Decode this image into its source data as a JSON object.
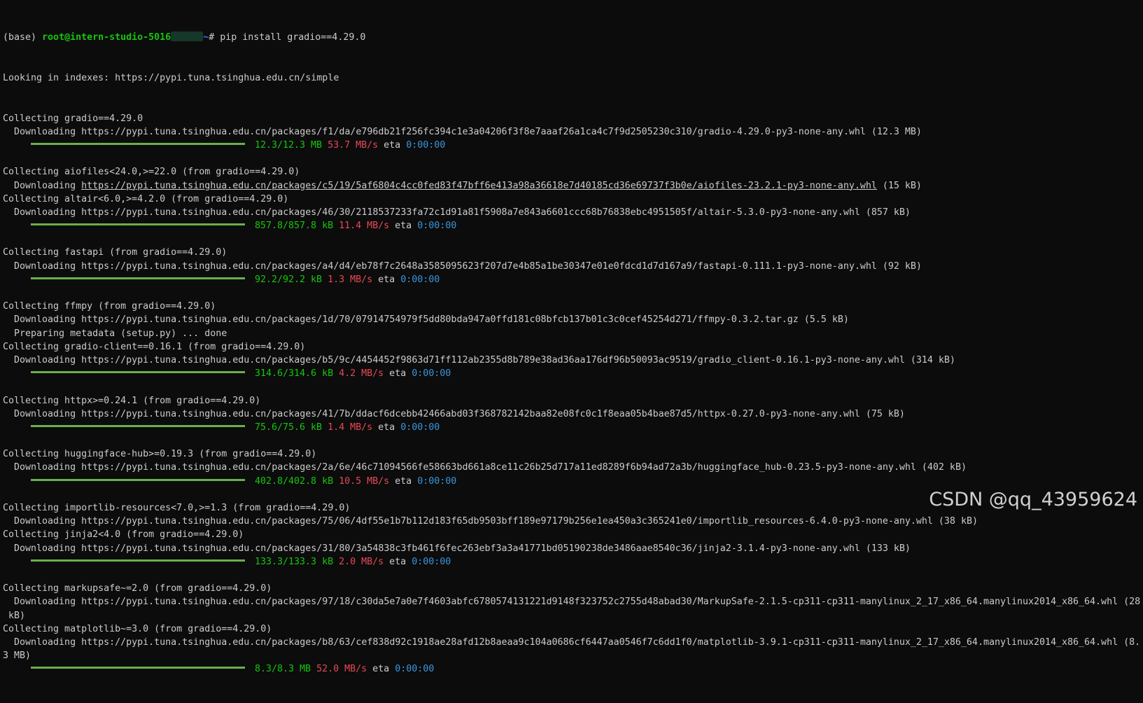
{
  "prompt": {
    "env": "(base) ",
    "user_host": "root@intern-studio-5016",
    "path": "~",
    "symbol": "# ",
    "command": "pip install gradio==4.29.0"
  },
  "index_line": "Looking in indexes: https://pypi.tuna.tsinghua.edu.cn/simple",
  "packages": [
    {
      "collecting": "Collecting gradio==4.29.0",
      "url": "https://pypi.tuna.tsinghua.edu.cn/packages/f1/da/e796db21f256fc394c1e3a04206f3f8e7aaaf26a1ca4c7f9d2505230c310/gradio-4.29.0-py3-none-any.whl",
      "size": "(12.3 MB)",
      "progress": {
        "size": "12.3/12.3 MB",
        "speed": "53.7 MB/s",
        "eta": "0:00:00"
      }
    },
    {
      "collecting": "Collecting aiofiles<24.0,>=22.0 (from gradio==4.29.0)",
      "url": "https://pypi.tuna.tsinghua.edu.cn/packages/c5/19/5af6804c4cc0fed83f47bff6e413a98a36618e7d40185cd36e69737f3b0e/aiofiles-23.2.1-py3-none-any.whl",
      "size": "(15 kB)",
      "underline": true
    },
    {
      "collecting": "Collecting altair<6.0,>=4.2.0 (from gradio==4.29.0)",
      "url": "https://pypi.tuna.tsinghua.edu.cn/packages/46/30/2118537233fa72c1d91a81f5908a7e843a6601ccc68b76838ebc4951505f/altair-5.3.0-py3-none-any.whl",
      "size": "(857 kB)",
      "progress": {
        "size": "857.8/857.8 kB",
        "speed": "11.4 MB/s",
        "eta": "0:00:00"
      }
    },
    {
      "collecting": "Collecting fastapi (from gradio==4.29.0)",
      "url": "https://pypi.tuna.tsinghua.edu.cn/packages/a4/d4/eb78f7c2648a3585095623f207d7e4b85a1be30347e01e0fdcd1d7d167a9/fastapi-0.111.1-py3-none-any.whl",
      "size": "(92 kB)",
      "progress": {
        "size": "92.2/92.2 kB",
        "speed": "1.3 MB/s",
        "eta": "0:00:00"
      }
    },
    {
      "collecting": "Collecting ffmpy (from gradio==4.29.0)",
      "url": "https://pypi.tuna.tsinghua.edu.cn/packages/1d/70/07914754979f5dd80bda947a0ffd181c08bfcb137b01c3c0cef45254d271/ffmpy-0.3.2.tar.gz",
      "size": "(5.5 kB)",
      "extra": "  Preparing metadata (setup.py) ... done"
    },
    {
      "collecting": "Collecting gradio-client==0.16.1 (from gradio==4.29.0)",
      "url": "https://pypi.tuna.tsinghua.edu.cn/packages/b5/9c/4454452f9863d71ff112ab2355d8b789e38ad36aa176df96b50093ac9519/gradio_client-0.16.1-py3-none-any.whl",
      "size": "(314 kB)",
      "progress": {
        "size": "314.6/314.6 kB",
        "speed": "4.2 MB/s",
        "eta": "0:00:00"
      }
    },
    {
      "collecting": "Collecting httpx>=0.24.1 (from gradio==4.29.0)",
      "url": "https://pypi.tuna.tsinghua.edu.cn/packages/41/7b/ddacf6dcebb42466abd03f368782142baa82e08fc0c1f8eaa05b4bae87d5/httpx-0.27.0-py3-none-any.whl",
      "size": "(75 kB)",
      "progress": {
        "size": "75.6/75.6 kB",
        "speed": "1.4 MB/s",
        "eta": "0:00:00"
      }
    },
    {
      "collecting": "Collecting huggingface-hub>=0.19.3 (from gradio==4.29.0)",
      "url": "https://pypi.tuna.tsinghua.edu.cn/packages/2a/6e/46c71094566fe58663bd661a8ce11c26b25d717a11ed8289f6b94ad72a3b/huggingface_hub-0.23.5-py3-none-any.whl",
      "size": "(402 kB)",
      "progress": {
        "size": "402.8/402.8 kB",
        "speed": "10.5 MB/s",
        "eta": "0:00:00"
      }
    },
    {
      "collecting": "Collecting importlib-resources<7.0,>=1.3 (from gradio==4.29.0)",
      "url": "https://pypi.tuna.tsinghua.edu.cn/packages/75/06/4df55e1b7b112d183f65db9503bff189e97179b256e1ea450a3c365241e0/importlib_resources-6.4.0-py3-none-any.whl",
      "size": "(38 kB)"
    },
    {
      "collecting": "Collecting jinja2<4.0 (from gradio==4.29.0)",
      "url": "https://pypi.tuna.tsinghua.edu.cn/packages/31/80/3a54838c3fb461f6fec263ebf3a3a41771bd05190238de3486aae8540c36/jinja2-3.1.4-py3-none-any.whl",
      "size": "(133 kB)",
      "progress": {
        "size": "133.3/133.3 kB",
        "speed": "2.0 MB/s",
        "eta": "0:00:00"
      }
    },
    {
      "collecting": "Collecting markupsafe~=2.0 (from gradio==4.29.0)",
      "url": "https://pypi.tuna.tsinghua.edu.cn/packages/97/18/c30da5e7a0e7f4603abfc6780574131221d9148f323752c2755d48abad30/MarkupSafe-2.1.5-cp311-cp311-manylinux_2_17_x86_64.manylinux2014_x86_64.whl",
      "size": "(28",
      "wrap": " kB)"
    },
    {
      "collecting": "Collecting matplotlib~=3.0 (from gradio==4.29.0)",
      "url": "https://pypi.tuna.tsinghua.edu.cn/packages/b8/63/cef838d92c1918ae28afd12b8aeaa9c104a0686cf6447aa0546f7c6dd1f0/matplotlib-3.9.1-cp311-cp311-manylinux_2_17_x86_64.manylinux2014_x86_64.whl",
      "size": "(8.",
      "wrap": "3 MB)",
      "progress": {
        "size": "8.3/8.3 MB",
        "speed": "52.0 MB/s",
        "eta": "0:00:00"
      }
    }
  ],
  "labels": {
    "downloading": "  Downloading ",
    "eta": "eta"
  },
  "watermark": "CSDN @qq_43959624",
  "colors": {
    "background": "#0c0c0c",
    "text": "#cccccc",
    "prompt_user": "#16c60c",
    "prompt_path": "#3b78ff",
    "progress_bar": "#6ab04c",
    "progress_size": "#16c60c",
    "progress_speed": "#e74856",
    "progress_eta": "#3a96dd"
  }
}
